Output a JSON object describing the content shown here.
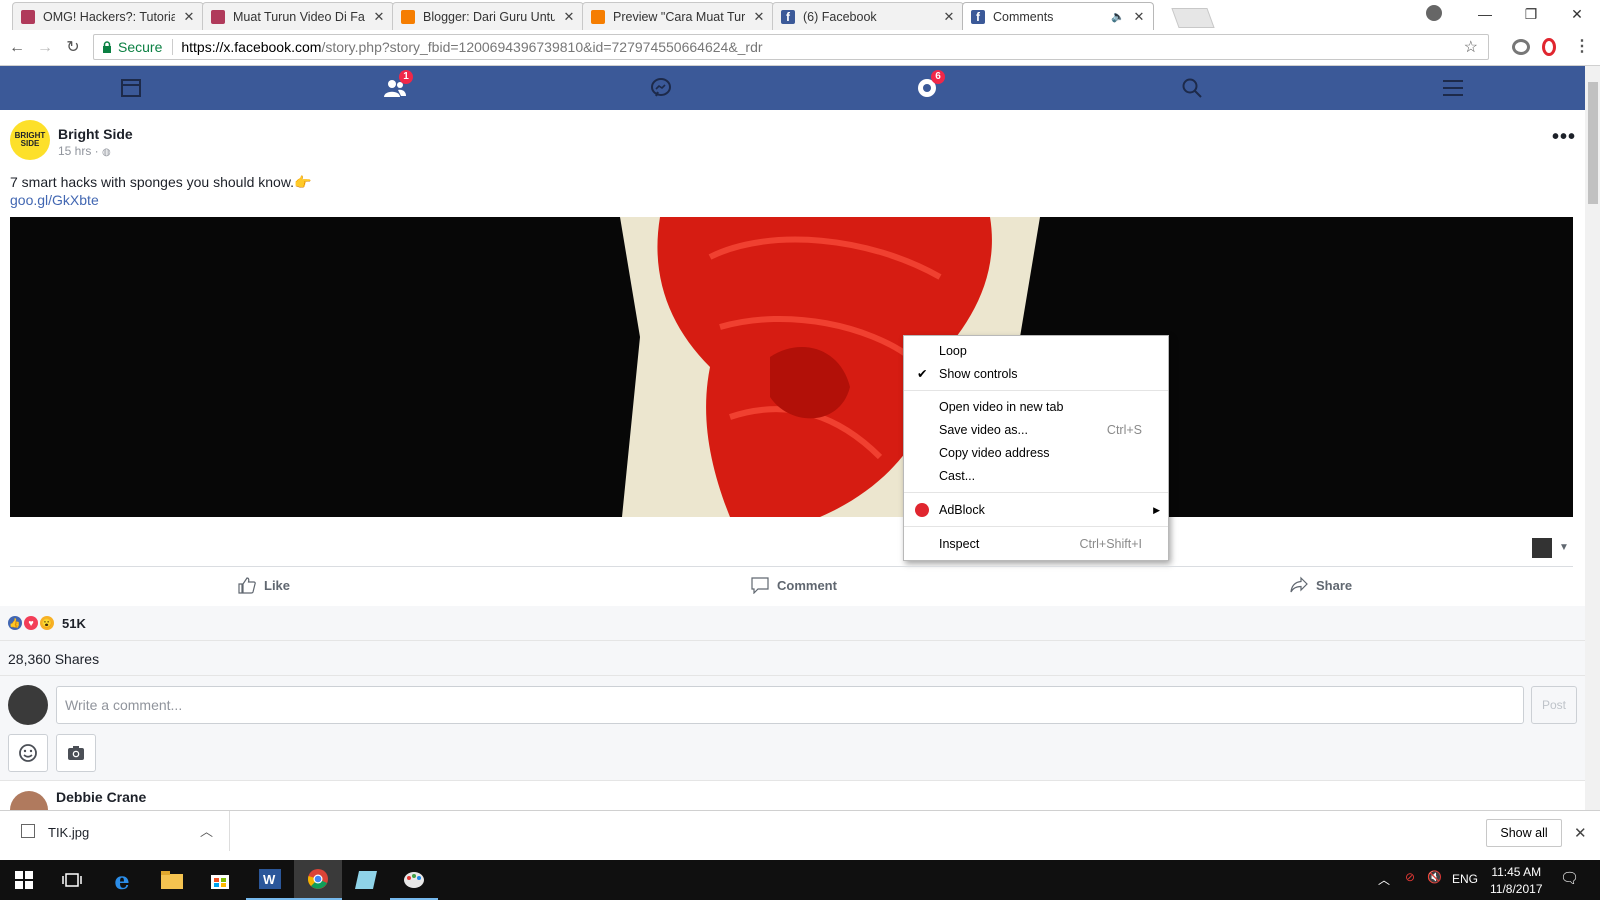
{
  "browser": {
    "tabs": [
      {
        "title": "OMG! Hackers?: Tutorial",
        "favicon": "hacker-site-icon"
      },
      {
        "title": "Muat Turun Video Di Fac",
        "favicon": "hacker-site-icon"
      },
      {
        "title": "Blogger: Dari Guru Untuk",
        "favicon": "blogger-icon"
      },
      {
        "title": "Preview \"Cara Muat Turu",
        "favicon": "blogger-icon"
      },
      {
        "title": "(6) Facebook",
        "favicon": "facebook-icon"
      },
      {
        "title": "Comments",
        "favicon": "facebook-icon",
        "active": true
      }
    ],
    "secure_label": "Secure",
    "url_host": "https://x.facebook.com",
    "url_rest": "/story.php?story_fbid=1200694396739810&id=727974550664624&_rdr"
  },
  "fb_nav": {
    "friend_requests_badge": "1",
    "notifications_badge": "6"
  },
  "post": {
    "page_name": "Bright Side",
    "avatar_text": "BRIGHT SIDE",
    "time": "15 hrs · ",
    "text": "7 smart hacks with sponges you should know.",
    "emoji": "👉",
    "link": "goo.gl/GkXbte"
  },
  "context_menu": {
    "items": [
      {
        "label": "Loop"
      },
      {
        "label": "Show controls",
        "checked": true
      },
      {
        "label": "Open video in new tab"
      },
      {
        "label": "Save video as...",
        "shortcut": "Ctrl+S"
      },
      {
        "label": "Copy video address"
      },
      {
        "label": "Cast..."
      },
      {
        "label": "AdBlock",
        "submenu": true
      },
      {
        "label": "Inspect",
        "shortcut": "Ctrl+Shift+I"
      }
    ]
  },
  "actions": {
    "like": "Like",
    "comment": "Comment",
    "share": "Share"
  },
  "reactions": {
    "count": "51K",
    "shares": "28,360 Shares"
  },
  "comment_box": {
    "placeholder": "Write a comment...",
    "post_label": "Post"
  },
  "next_commenter": "Debbie Crane",
  "download_shelf": {
    "file": "TIK.jpg",
    "show_all": "Show all"
  },
  "taskbar": {
    "lang": "ENG",
    "time": "11:45 AM",
    "date": "11/8/2017"
  },
  "colors": {
    "fb_blue": "#3b5998",
    "link_blue": "#4267b2",
    "badge_red": "#f02849"
  }
}
